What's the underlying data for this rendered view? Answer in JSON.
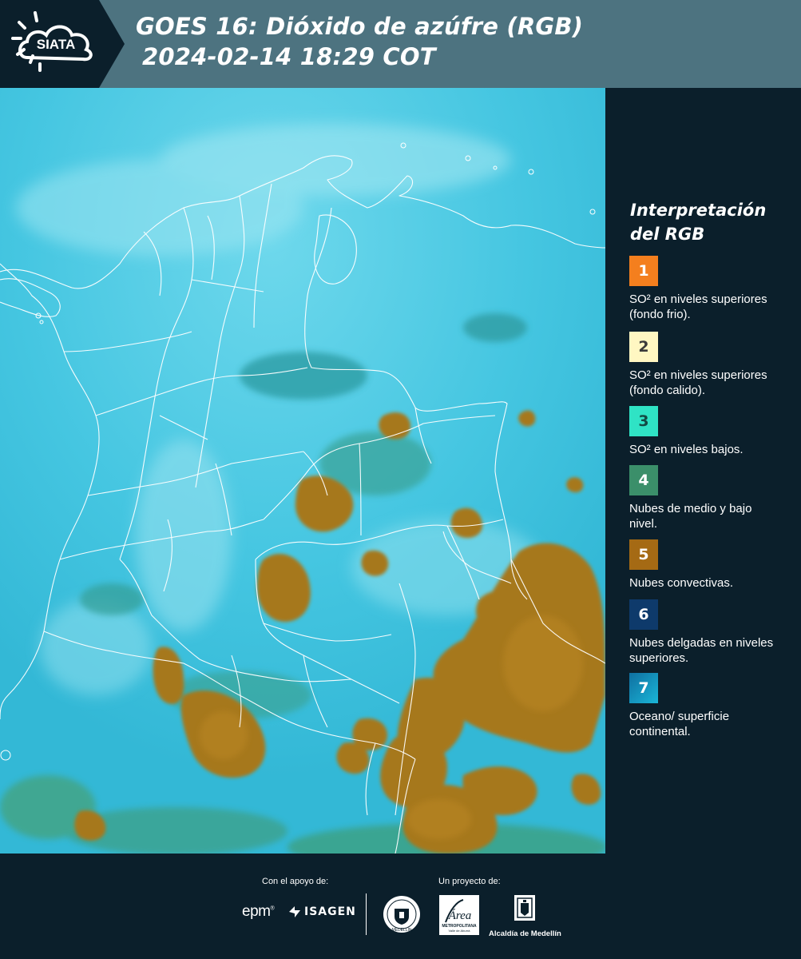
{
  "header": {
    "logo_text": "SIATA",
    "title_line1": "GOES 16: Dióxido de azúfre (RGB)",
    "title_line2": "2024-02-14 18:29 COT"
  },
  "map": {
    "ocean_color": "#3fc4e0",
    "convective_cloud_color": "#a6781c",
    "boundary_color": "#ffffff"
  },
  "legend": {
    "title": "Interpretación del RGB",
    "items": [
      {
        "number": "1",
        "color": "#f47f1e",
        "text_color": "#ffffff",
        "label": "SO² en niveles superiores (fondo frio)."
      },
      {
        "number": "2",
        "color": "#fff7c2",
        "text_color": "#3a3a3a",
        "label": "SO² en niveles superiores (fondo calido)."
      },
      {
        "number": "3",
        "color": "#2fe3c5",
        "text_color": "#134a44",
        "label": "SO² en niveles bajos."
      },
      {
        "number": "4",
        "color": "#3b8f6a",
        "text_color": "#ffffff",
        "label": "Nubes de medio y bajo nivel."
      },
      {
        "number": "5",
        "color": "#a56a14",
        "text_color": "#ffffff",
        "label": "Nubes convectivas."
      },
      {
        "number": "6",
        "color": "#0e3a6b",
        "text_color": "#ffffff",
        "label": "Nubes delgadas en niveles superiores."
      },
      {
        "number": "7",
        "color": "#1aa0c9",
        "text_color": "#ffffff",
        "label": "Oceano/ superficie continental."
      }
    ]
  },
  "footer": {
    "support_label": "Con el apoyo de:",
    "project_label": "Un proyecto de:",
    "epm_logo": "epm",
    "isagen_logo": "ISAGEN",
    "area_logo": "Área",
    "area_subtext": "METROPOLITANA",
    "area_subtext2": "Valle de Aburrá",
    "alcaldia_logo": "Alcaldía de Medellín",
    "seal_text": "MEDELLÍN"
  }
}
